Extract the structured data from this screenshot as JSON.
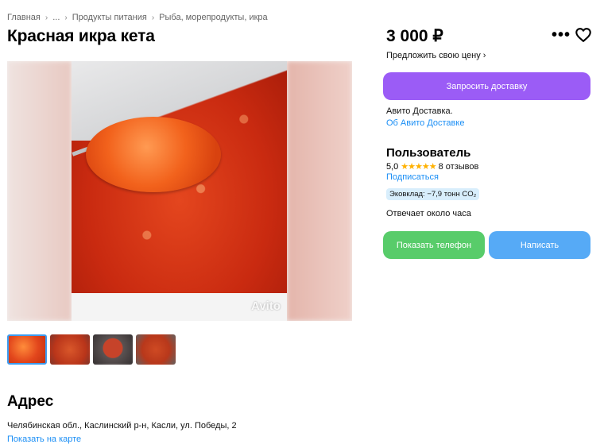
{
  "breadcrumbs": [
    "Главная",
    "...",
    "Продукты питания",
    "Рыба, морепродукты, икра"
  ],
  "title": "Красная икра кета",
  "gallery": {
    "watermark": "Avito",
    "thumbnail_count": 4
  },
  "address": {
    "heading": "Адрес",
    "text": "Челябинская обл., Каслинский р-н, Касли, ул. Победы, 2",
    "map_link": "Показать на карте"
  },
  "price": {
    "value": "3 000 ₽",
    "offer_link": "Предложить свою цену"
  },
  "actions": {
    "more_icon": "more-dots-icon",
    "favorite_icon": "heart-icon",
    "request_delivery": "Запросить доставку",
    "show_phone": "Показать телефон",
    "write": "Написать"
  },
  "delivery": {
    "text": "Авито Доставка.",
    "link": "Об Авито Доставке"
  },
  "seller": {
    "name": "Пользователь",
    "rating": "5,0",
    "stars": "★★★★★",
    "reviews": "8 отзывов",
    "subscribe": "Подписаться",
    "eco_badge": "Эковклад: −7,9 тонн CO₂",
    "response_time": "Отвечает около часа"
  },
  "colors": {
    "accent_purple": "#9b5cf6",
    "phone_green": "#58cc6a",
    "write_blue": "#56aaf6",
    "link_blue": "#1a8ef5",
    "star_yellow": "#ffb100",
    "eco_badge_bg": "#d8eefc"
  }
}
